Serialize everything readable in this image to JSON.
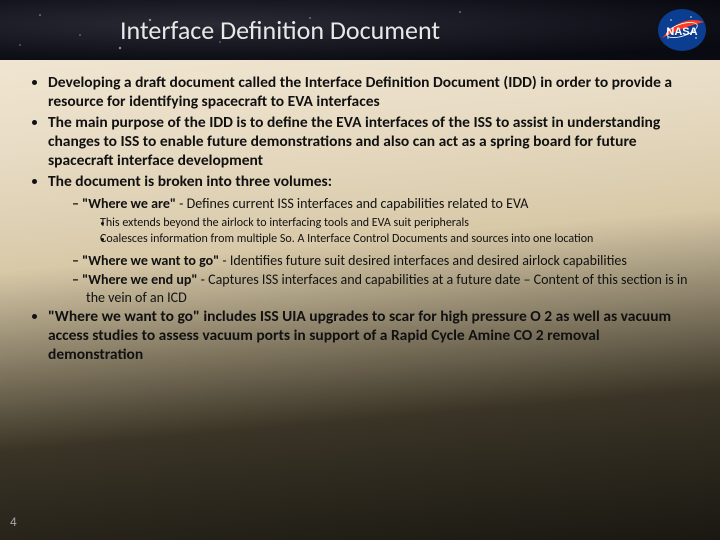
{
  "title": "Interface Definition Document",
  "logo_name": "nasa-logo",
  "page_number": "4",
  "bullets": {
    "b1": "Developing a draft document called the Interface Definition Document (IDD) in order to provide a resource for identifying spacecraft to EVA interfaces",
    "b2": "The main purpose of the IDD is to define the EVA interfaces of the ISS to assist in understanding changes to ISS to enable future demonstrations and also can act as a spring board for future spacecraft interface development",
    "b3": "The document is broken into three volumes:",
    "b4": "\"Where we want to go\" includes ISS UIA upgrades to scar for high pressure O 2 as well as vacuum access studies to assess vacuum ports in support of a Rapid Cycle Amine CO 2 removal demonstration"
  },
  "sub": {
    "s1a": "\"Where we are\"",
    "s1b": " - Defines current ISS interfaces and capabilities related to EVA",
    "s2a": "\"Where we want to go\"",
    "s2b": " - Identifies future suit desired interfaces and desired airlock capabilities",
    "s3a": "\"Where we end up\"",
    "s3b": " - Captures ISS interfaces and capabilities at a future date  – Content of this section is in the vein of an ICD"
  },
  "subsub": {
    "ss1": "This extends beyond the airlock to interfacing tools and EVA suit peripherals",
    "ss2": "Coalesces information from multiple So. A Interface Control Documents and sources into one location"
  }
}
